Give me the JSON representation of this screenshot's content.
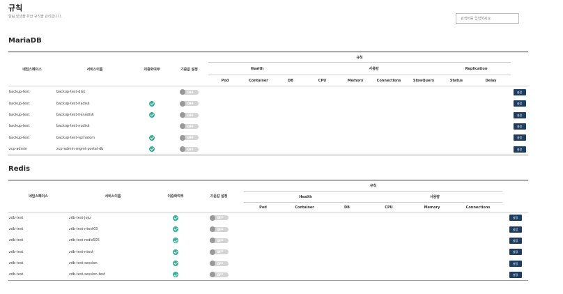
{
  "page": {
    "title": "규칙",
    "subtitle": "알림 발생을 위한 규칙을 관리합니다.",
    "search_placeholder": "검색어를 입력하세요."
  },
  "headers": {
    "namespace": "네임스페이스",
    "service": "서비스이름",
    "redundancy": "이중화여부",
    "default": "기준값 설정",
    "rules": "규칙",
    "health": "Health",
    "usage": "사용량",
    "replication": "Replication",
    "pod": "Pod",
    "container": "Container",
    "db": "DB",
    "cpu": "CPU",
    "memory": "Memory",
    "connections": "Connections",
    "slowquery": "SlowQuery",
    "status": "Status",
    "delay": "Delay"
  },
  "toggle_label": "OFF",
  "button_label": "설정",
  "mariadb": {
    "title": "MariaDB",
    "rows": [
      {
        "ns": "backup-test",
        "svc": "backup-test-disk",
        "redundant": false
      },
      {
        "ns": "backup-test",
        "svc": "backup-test-hadisk",
        "redundant": true
      },
      {
        "ns": "backup-test",
        "svc": "backup-test-henodisk",
        "redundant": true
      },
      {
        "ns": "backup-test",
        "svc": "backup-test-nodisk",
        "redundant": false
      },
      {
        "ns": "backup-test",
        "svc": "backup-test-vpmatom",
        "redundant": true
      },
      {
        "ns": "zcp-admin",
        "svc": "zcp-admin-mgmt-portal-db",
        "redundant": true
      }
    ]
  },
  "redis": {
    "title": "Redis",
    "rows": [
      {
        "ns": "zdb-test",
        "svc": "zdb-test-jeju",
        "redundant": true
      },
      {
        "ns": "zdb-test",
        "svc": "zdb-test-ntest03",
        "redundant": true
      },
      {
        "ns": "zdb-test",
        "svc": "zdb-test-redis505",
        "redundant": true
      },
      {
        "ns": "zdb-test",
        "svc": "zdb-test-ntest",
        "redundant": true
      },
      {
        "ns": "zdb-test",
        "svc": "zdb-test-session",
        "redundant": true
      },
      {
        "ns": "zdb-test",
        "svc": "zdb-test-session-test",
        "redundant": true
      }
    ]
  },
  "colors": {
    "check": "#35b29a",
    "button": "#1d3d63",
    "toggle": "#d5d5d5"
  }
}
